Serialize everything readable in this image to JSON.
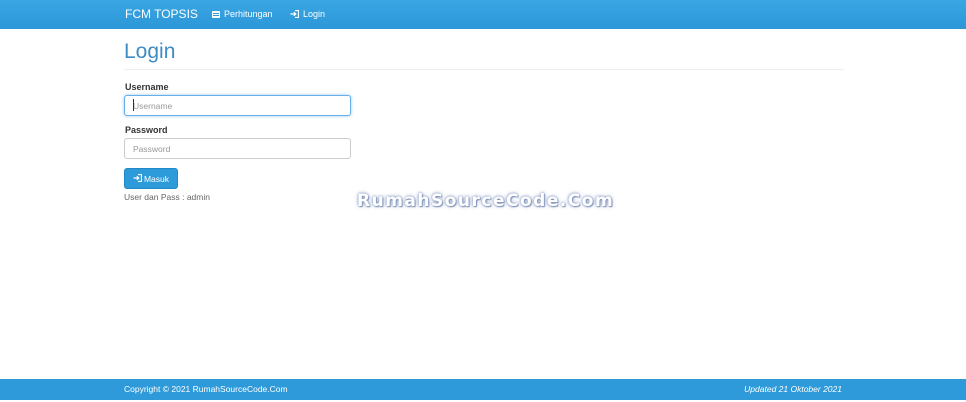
{
  "navbar": {
    "brand": "FCM TOPSIS",
    "items": [
      {
        "label": "Perhitungan",
        "icon": "table-icon"
      },
      {
        "label": "Login",
        "icon": "login-icon"
      }
    ]
  },
  "main": {
    "title": "Login",
    "username": {
      "label": "Username",
      "placeholder": "Username",
      "value": ""
    },
    "password": {
      "label": "Password",
      "placeholder": "Password",
      "value": ""
    },
    "submit": {
      "label": "Masuk",
      "icon": "login-icon"
    },
    "hint": "User dan Pass : admin"
  },
  "watermark": "RumahSourceCode.Com",
  "footer": {
    "copyright": "Copyright © 2021 RumahSourceCode.Com",
    "updated": "Updated 21 Oktober 2021"
  },
  "colors": {
    "navbar": "#2e99da",
    "title": "#3d8cc4",
    "button": "#2d9ad9",
    "footer": "#2e9ad9"
  }
}
